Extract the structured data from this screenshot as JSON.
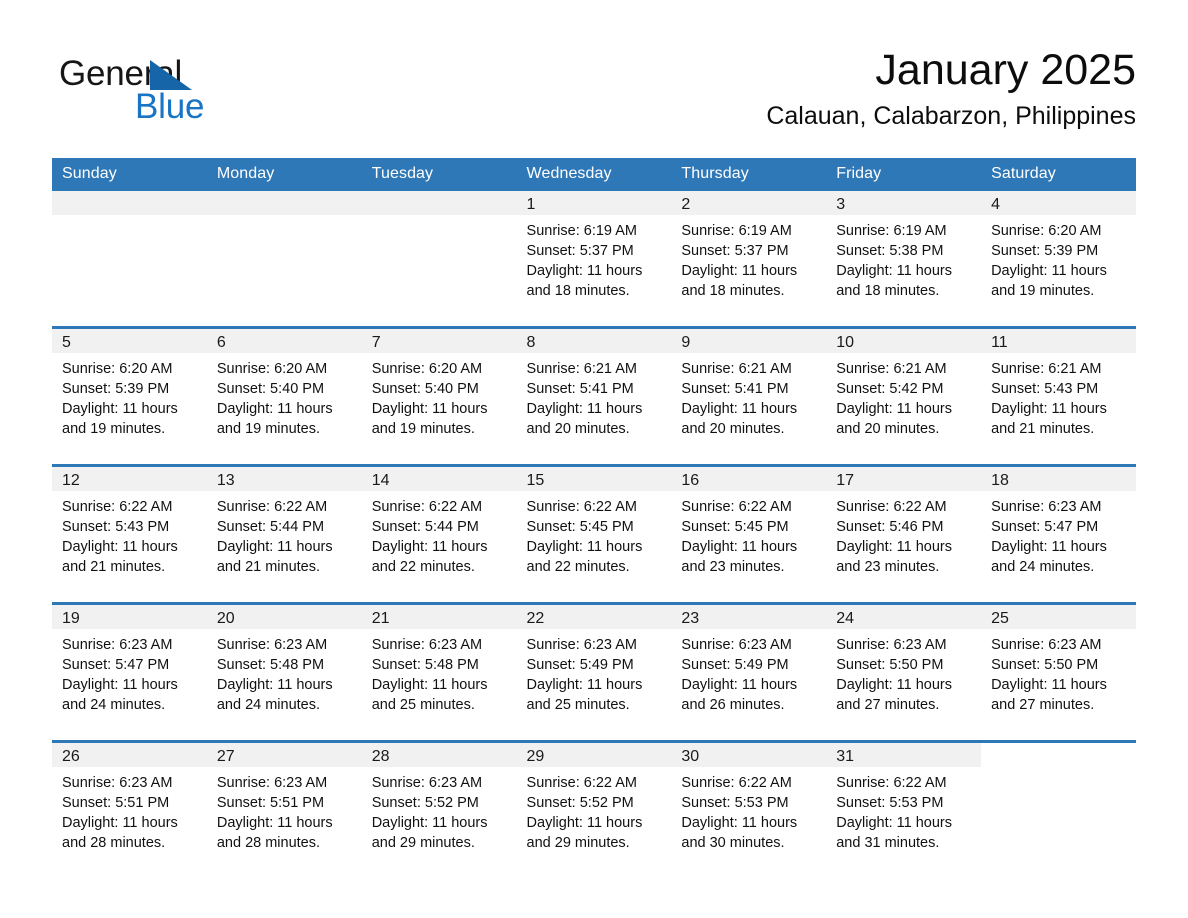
{
  "brand": {
    "name_part1": "General",
    "name_part2": "Blue",
    "accent_color": "#1874c4",
    "triangle_color": "#1565a8"
  },
  "header": {
    "month_title": "January 2025",
    "location": "Calauan, Calabarzon, Philippines"
  },
  "calendar": {
    "header_bg": "#2f78b8",
    "date_band_bg": "#f1f1f1",
    "weekday_headers": [
      "Sunday",
      "Monday",
      "Tuesday",
      "Wednesday",
      "Thursday",
      "Friday",
      "Saturday"
    ],
    "weeks": [
      [
        {
          "day": "",
          "sunrise": "",
          "sunset": "",
          "daylight_l1": "",
          "daylight_l2": "",
          "shaded": true
        },
        {
          "day": "",
          "sunrise": "",
          "sunset": "",
          "daylight_l1": "",
          "daylight_l2": "",
          "shaded": true
        },
        {
          "day": "",
          "sunrise": "",
          "sunset": "",
          "daylight_l1": "",
          "daylight_l2": "",
          "shaded": true
        },
        {
          "day": "1",
          "sunrise": "Sunrise: 6:19 AM",
          "sunset": "Sunset: 5:37 PM",
          "daylight_l1": "Daylight: 11 hours",
          "daylight_l2": "and 18 minutes.",
          "shaded": true
        },
        {
          "day": "2",
          "sunrise": "Sunrise: 6:19 AM",
          "sunset": "Sunset: 5:37 PM",
          "daylight_l1": "Daylight: 11 hours",
          "daylight_l2": "and 18 minutes.",
          "shaded": true
        },
        {
          "day": "3",
          "sunrise": "Sunrise: 6:19 AM",
          "sunset": "Sunset: 5:38 PM",
          "daylight_l1": "Daylight: 11 hours",
          "daylight_l2": "and 18 minutes.",
          "shaded": true
        },
        {
          "day": "4",
          "sunrise": "Sunrise: 6:20 AM",
          "sunset": "Sunset: 5:39 PM",
          "daylight_l1": "Daylight: 11 hours",
          "daylight_l2": "and 19 minutes.",
          "shaded": true
        }
      ],
      [
        {
          "day": "5",
          "sunrise": "Sunrise: 6:20 AM",
          "sunset": "Sunset: 5:39 PM",
          "daylight_l1": "Daylight: 11 hours",
          "daylight_l2": "and 19 minutes.",
          "shaded": true
        },
        {
          "day": "6",
          "sunrise": "Sunrise: 6:20 AM",
          "sunset": "Sunset: 5:40 PM",
          "daylight_l1": "Daylight: 11 hours",
          "daylight_l2": "and 19 minutes.",
          "shaded": true
        },
        {
          "day": "7",
          "sunrise": "Sunrise: 6:20 AM",
          "sunset": "Sunset: 5:40 PM",
          "daylight_l1": "Daylight: 11 hours",
          "daylight_l2": "and 19 minutes.",
          "shaded": true
        },
        {
          "day": "8",
          "sunrise": "Sunrise: 6:21 AM",
          "sunset": "Sunset: 5:41 PM",
          "daylight_l1": "Daylight: 11 hours",
          "daylight_l2": "and 20 minutes.",
          "shaded": true
        },
        {
          "day": "9",
          "sunrise": "Sunrise: 6:21 AM",
          "sunset": "Sunset: 5:41 PM",
          "daylight_l1": "Daylight: 11 hours",
          "daylight_l2": "and 20 minutes.",
          "shaded": true
        },
        {
          "day": "10",
          "sunrise": "Sunrise: 6:21 AM",
          "sunset": "Sunset: 5:42 PM",
          "daylight_l1": "Daylight: 11 hours",
          "daylight_l2": "and 20 minutes.",
          "shaded": true
        },
        {
          "day": "11",
          "sunrise": "Sunrise: 6:21 AM",
          "sunset": "Sunset: 5:43 PM",
          "daylight_l1": "Daylight: 11 hours",
          "daylight_l2": "and 21 minutes.",
          "shaded": true
        }
      ],
      [
        {
          "day": "12",
          "sunrise": "Sunrise: 6:22 AM",
          "sunset": "Sunset: 5:43 PM",
          "daylight_l1": "Daylight: 11 hours",
          "daylight_l2": "and 21 minutes.",
          "shaded": true
        },
        {
          "day": "13",
          "sunrise": "Sunrise: 6:22 AM",
          "sunset": "Sunset: 5:44 PM",
          "daylight_l1": "Daylight: 11 hours",
          "daylight_l2": "and 21 minutes.",
          "shaded": true
        },
        {
          "day": "14",
          "sunrise": "Sunrise: 6:22 AM",
          "sunset": "Sunset: 5:44 PM",
          "daylight_l1": "Daylight: 11 hours",
          "daylight_l2": "and 22 minutes.",
          "shaded": true
        },
        {
          "day": "15",
          "sunrise": "Sunrise: 6:22 AM",
          "sunset": "Sunset: 5:45 PM",
          "daylight_l1": "Daylight: 11 hours",
          "daylight_l2": "and 22 minutes.",
          "shaded": true
        },
        {
          "day": "16",
          "sunrise": "Sunrise: 6:22 AM",
          "sunset": "Sunset: 5:45 PM",
          "daylight_l1": "Daylight: 11 hours",
          "daylight_l2": "and 23 minutes.",
          "shaded": true
        },
        {
          "day": "17",
          "sunrise": "Sunrise: 6:22 AM",
          "sunset": "Sunset: 5:46 PM",
          "daylight_l1": "Daylight: 11 hours",
          "daylight_l2": "and 23 minutes.",
          "shaded": true
        },
        {
          "day": "18",
          "sunrise": "Sunrise: 6:23 AM",
          "sunset": "Sunset: 5:47 PM",
          "daylight_l1": "Daylight: 11 hours",
          "daylight_l2": "and 24 minutes.",
          "shaded": true
        }
      ],
      [
        {
          "day": "19",
          "sunrise": "Sunrise: 6:23 AM",
          "sunset": "Sunset: 5:47 PM",
          "daylight_l1": "Daylight: 11 hours",
          "daylight_l2": "and 24 minutes.",
          "shaded": true
        },
        {
          "day": "20",
          "sunrise": "Sunrise: 6:23 AM",
          "sunset": "Sunset: 5:48 PM",
          "daylight_l1": "Daylight: 11 hours",
          "daylight_l2": "and 24 minutes.",
          "shaded": true
        },
        {
          "day": "21",
          "sunrise": "Sunrise: 6:23 AM",
          "sunset": "Sunset: 5:48 PM",
          "daylight_l1": "Daylight: 11 hours",
          "daylight_l2": "and 25 minutes.",
          "shaded": true
        },
        {
          "day": "22",
          "sunrise": "Sunrise: 6:23 AM",
          "sunset": "Sunset: 5:49 PM",
          "daylight_l1": "Daylight: 11 hours",
          "daylight_l2": "and 25 minutes.",
          "shaded": true
        },
        {
          "day": "23",
          "sunrise": "Sunrise: 6:23 AM",
          "sunset": "Sunset: 5:49 PM",
          "daylight_l1": "Daylight: 11 hours",
          "daylight_l2": "and 26 minutes.",
          "shaded": true
        },
        {
          "day": "24",
          "sunrise": "Sunrise: 6:23 AM",
          "sunset": "Sunset: 5:50 PM",
          "daylight_l1": "Daylight: 11 hours",
          "daylight_l2": "and 27 minutes.",
          "shaded": true
        },
        {
          "day": "25",
          "sunrise": "Sunrise: 6:23 AM",
          "sunset": "Sunset: 5:50 PM",
          "daylight_l1": "Daylight: 11 hours",
          "daylight_l2": "and 27 minutes.",
          "shaded": true
        }
      ],
      [
        {
          "day": "26",
          "sunrise": "Sunrise: 6:23 AM",
          "sunset": "Sunset: 5:51 PM",
          "daylight_l1": "Daylight: 11 hours",
          "daylight_l2": "and 28 minutes.",
          "shaded": true
        },
        {
          "day": "27",
          "sunrise": "Sunrise: 6:23 AM",
          "sunset": "Sunset: 5:51 PM",
          "daylight_l1": "Daylight: 11 hours",
          "daylight_l2": "and 28 minutes.",
          "shaded": true
        },
        {
          "day": "28",
          "sunrise": "Sunrise: 6:23 AM",
          "sunset": "Sunset: 5:52 PM",
          "daylight_l1": "Daylight: 11 hours",
          "daylight_l2": "and 29 minutes.",
          "shaded": true
        },
        {
          "day": "29",
          "sunrise": "Sunrise: 6:22 AM",
          "sunset": "Sunset: 5:52 PM",
          "daylight_l1": "Daylight: 11 hours",
          "daylight_l2": "and 29 minutes.",
          "shaded": true
        },
        {
          "day": "30",
          "sunrise": "Sunrise: 6:22 AM",
          "sunset": "Sunset: 5:53 PM",
          "daylight_l1": "Daylight: 11 hours",
          "daylight_l2": "and 30 minutes.",
          "shaded": true
        },
        {
          "day": "31",
          "sunrise": "Sunrise: 6:22 AM",
          "sunset": "Sunset: 5:53 PM",
          "daylight_l1": "Daylight: 11 hours",
          "daylight_l2": "and 31 minutes.",
          "shaded": true
        },
        {
          "day": "",
          "sunrise": "",
          "sunset": "",
          "daylight_l1": "",
          "daylight_l2": "",
          "shaded": false
        }
      ]
    ]
  }
}
